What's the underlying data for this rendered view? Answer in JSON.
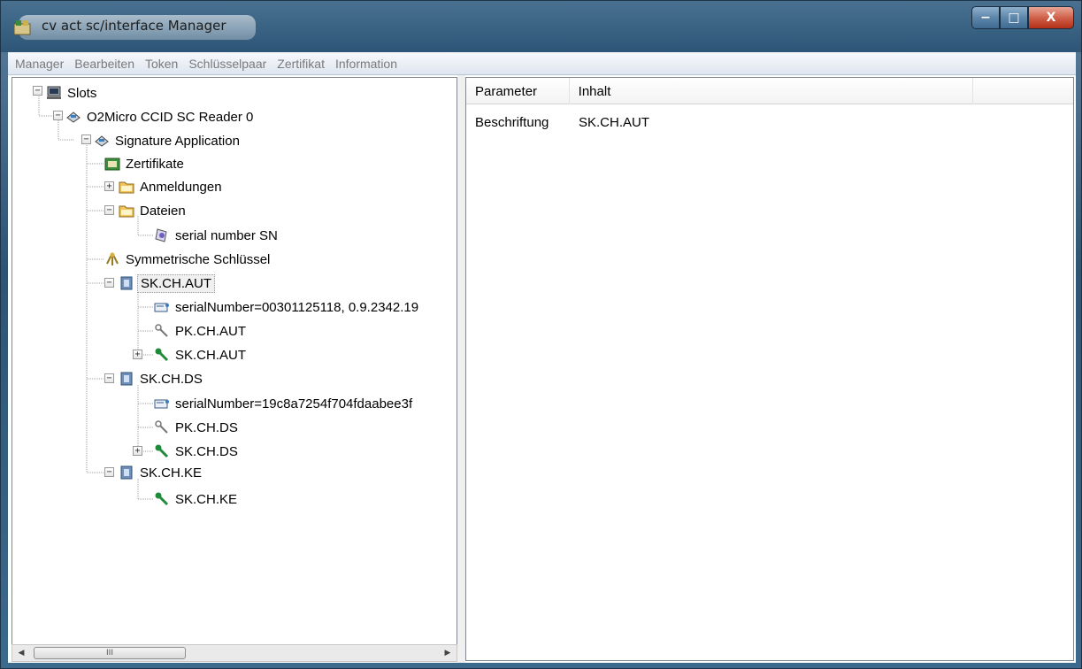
{
  "window": {
    "title": "cv act sc/interface Manager",
    "caption_buttons": {
      "minimize": "−",
      "maximize": "□",
      "close": "X"
    }
  },
  "menu": [
    "Manager",
    "Bearbeiten",
    "Token",
    "Schlüsselpaar",
    "Zertifikat",
    "Information"
  ],
  "tree": {
    "slots": "Slots",
    "reader": "O2Micro CCID SC Reader 0",
    "app": "Signature Application",
    "zertifikate": "Zertifikate",
    "anmeldungen": "Anmeldungen",
    "dateien": "Dateien",
    "serial_file": "serial number SN",
    "sym": "Symmetrische Schlüssel",
    "aut": {
      "label": "SK.CH.AUT",
      "cert": "serialNumber=00301125118, 0.9.2342.19",
      "pk": "PK.CH.AUT",
      "sk": "SK.CH.AUT"
    },
    "ds": {
      "label": "SK.CH.DS",
      "cert": "serialNumber=19c8a7254f704fdaabee3f",
      "pk": "PK.CH.DS",
      "sk": "SK.CH.DS"
    },
    "ke": {
      "label": "SK.CH.KE",
      "sk": "SK.CH.KE"
    }
  },
  "scrollbar": {
    "left_arrow": "◀",
    "thumb_grip": "III",
    "right_arrow": "▶"
  },
  "list": {
    "columns": [
      "Parameter",
      "Inhalt"
    ],
    "rows": [
      {
        "parameter": "Beschriftung",
        "inhalt": "SK.CH.AUT"
      }
    ]
  }
}
